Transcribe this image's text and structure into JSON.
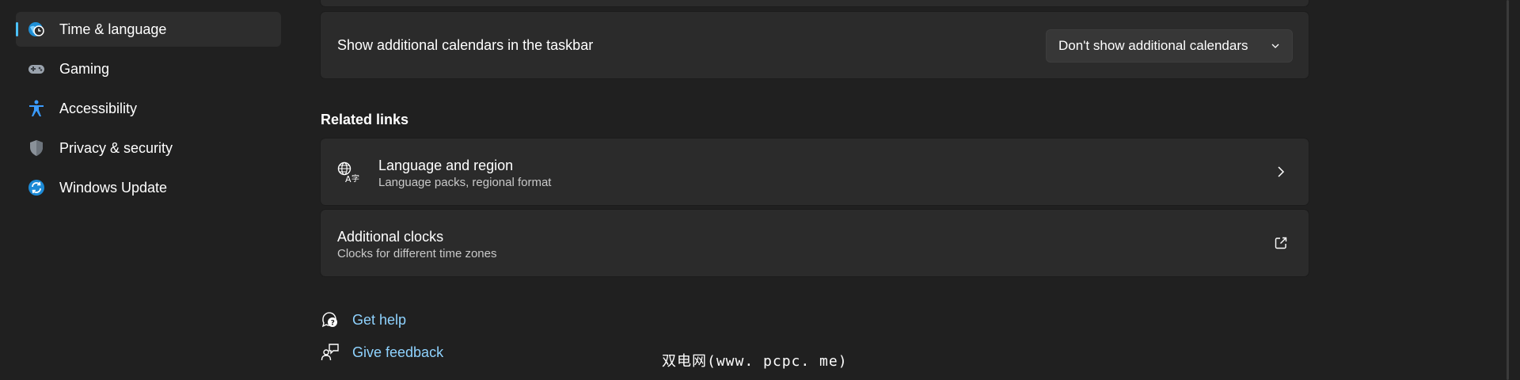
{
  "sidebar": {
    "items": [
      {
        "label": "Time & language",
        "icon": "globe-clock-icon",
        "selected": true
      },
      {
        "label": "Gaming",
        "icon": "gamepad-icon",
        "selected": false
      },
      {
        "label": "Accessibility",
        "icon": "accessibility-person-icon",
        "selected": false
      },
      {
        "label": "Privacy & security",
        "icon": "shield-icon",
        "selected": false
      },
      {
        "label": "Windows Update",
        "icon": "sync-icon",
        "selected": false
      }
    ]
  },
  "main": {
    "calendar_setting": {
      "title": "Show additional calendars in the taskbar",
      "dropdown_value": "Don't show additional calendars"
    },
    "related_links": {
      "title": "Related links",
      "items": [
        {
          "title": "Language and region",
          "subtitle": "Language packs, regional format",
          "icon": "language-icon",
          "action_icon": "chevron-right-icon"
        },
        {
          "title": "Additional clocks",
          "subtitle": "Clocks for different time zones",
          "action_icon": "open-external-icon"
        }
      ]
    },
    "footer": {
      "get_help": "Get help",
      "give_feedback": "Give feedback"
    }
  },
  "watermark": "双电网(www. pcpc. me)",
  "colors": {
    "background": "#202020",
    "card": "#2b2b2b",
    "accent": "#4cc2ff",
    "link": "#8fd3ff"
  }
}
